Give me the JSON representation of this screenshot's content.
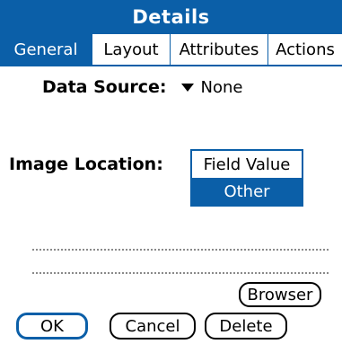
{
  "dialog": {
    "title": "Details"
  },
  "tabs": [
    {
      "label": "General",
      "active": true
    },
    {
      "label": "Layout",
      "active": false
    },
    {
      "label": "Attributes",
      "active": false
    },
    {
      "label": "Actions",
      "active": false
    }
  ],
  "data_source": {
    "label": "Data Source:",
    "value": "None"
  },
  "image_location": {
    "label": "Image Location:",
    "options": [
      "Field Value",
      "Other"
    ],
    "selected": "Other"
  },
  "buttons": {
    "browser": "Browser",
    "ok": "OK",
    "cancel": "Cancel",
    "delete": "Delete"
  },
  "colors": {
    "accent": "#0b5fa8",
    "background": "#ffffff"
  }
}
